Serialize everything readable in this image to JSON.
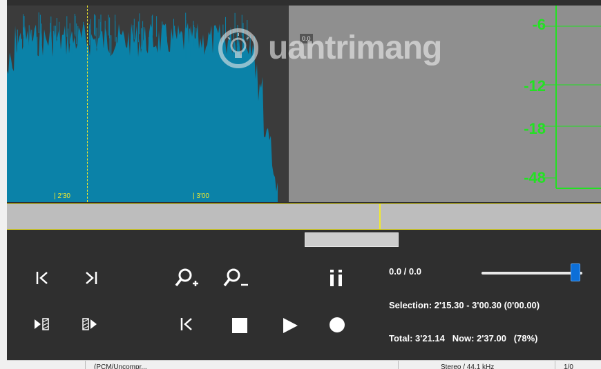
{
  "waveform": {
    "time_labels": [
      "| 2'30",
      "| 3'00"
    ],
    "marker_value": "0.0",
    "wave_color": "#0b82a8",
    "cursor_color": "#f2ea2b"
  },
  "meter": {
    "labels": [
      "-6",
      "-12",
      "-18",
      "-48"
    ],
    "color": "#22e222"
  },
  "watermark": {
    "text": "uantrimang",
    "icon": "lightbulb-gear-icon"
  },
  "controls": {
    "row1": [
      {
        "name": "skip-to-start-icon"
      },
      {
        "name": "skip-to-end-icon"
      },
      {
        "name": "zoom-in-icon"
      },
      {
        "name": "zoom-out-icon"
      },
      {
        "name": "pause-icon"
      }
    ],
    "row2": [
      {
        "name": "play-selection-icon"
      },
      {
        "name": "play-after-selection-icon"
      },
      {
        "name": "rewind-icon"
      },
      {
        "name": "stop-icon"
      },
      {
        "name": "play-icon"
      },
      {
        "name": "record-icon"
      }
    ]
  },
  "info": {
    "level": "0.0 / 0.0",
    "selection": "Selection: 2'15.30 - 3'00.30 (0'00.00)",
    "total": "Total: 3'21.14   Now: 2'37.00   (78%)"
  },
  "volume": {
    "level": 0.93,
    "thumb_color": "#0c6fd8"
  },
  "status_bar": {
    "cells": [
      "",
      "(PCM/Uncompr...",
      "Stereo / 44.1 kHz",
      "1/0"
    ]
  }
}
